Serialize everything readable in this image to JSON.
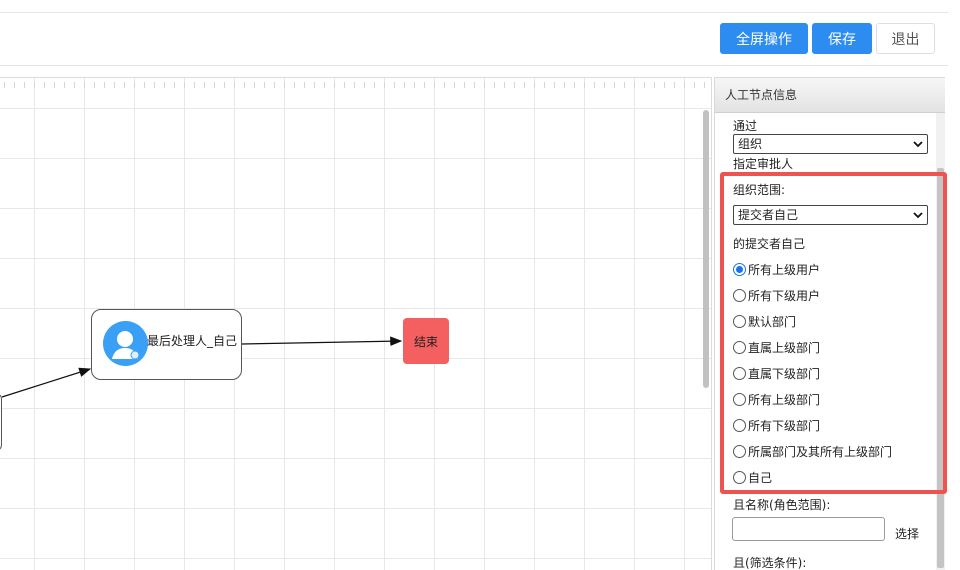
{
  "toolbar": {
    "fullscreen_label": "全屏操作",
    "save_label": "保存",
    "exit_label": "退出"
  },
  "canvas": {
    "user_node_label": "最后处理人_自己",
    "end_node_label": "结束"
  },
  "panel": {
    "title": "人工节点信息",
    "pass_label": "通过",
    "pass_select_value": "组织",
    "assign_approver_label": "指定审批人",
    "org_scope_label": "组织范围:",
    "org_scope_select_value": "提交者自己",
    "submitter_of_label": "的提交者自己",
    "radio_options": [
      {
        "label": "所有上级用户",
        "checked": true
      },
      {
        "label": "所有下级用户",
        "checked": false
      },
      {
        "label": "默认部门",
        "checked": false
      },
      {
        "label": "直属上级部门",
        "checked": false
      },
      {
        "label": "直属下级部门",
        "checked": false
      },
      {
        "label": "所有上级部门",
        "checked": false
      },
      {
        "label": "所有下级部门",
        "checked": false
      },
      {
        "label": "所属部门及其所有上级部门",
        "checked": false
      },
      {
        "label": "自己",
        "checked": false
      }
    ],
    "role_scope_label": "且名称(角色范围):",
    "select_label": "选择",
    "filter_label": "且(筛选条件):"
  },
  "colors": {
    "primary": "#2d8cf0",
    "end_node": "#f46060",
    "avatar": "#3aa0f5",
    "highlight": "#ef5350",
    "radio_checked": "#1a73e8"
  },
  "icons": {
    "avatar": "user-avatar-icon",
    "select_arrow": "chevron-down-icon"
  }
}
